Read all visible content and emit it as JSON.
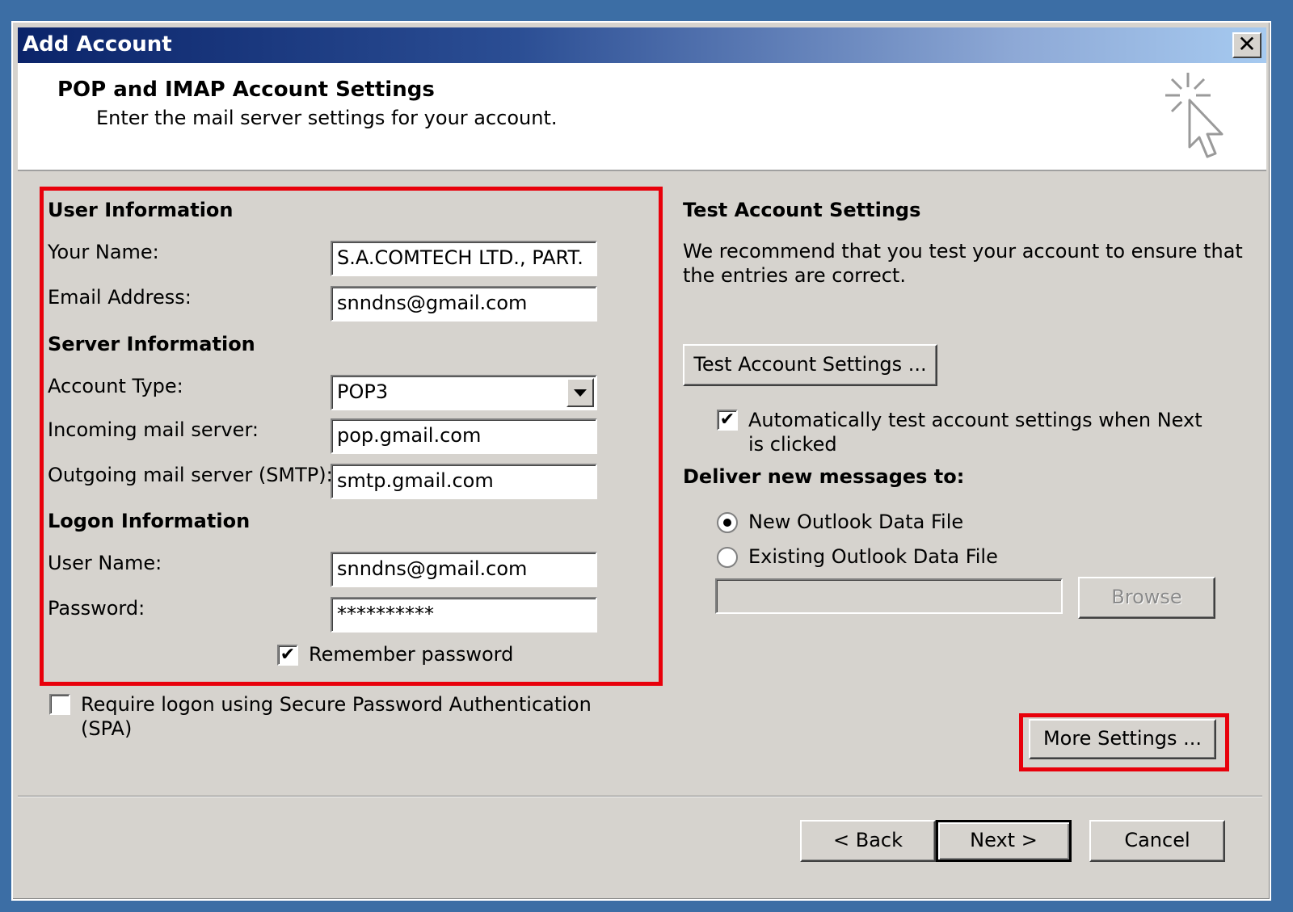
{
  "window": {
    "title": "Add Account",
    "close_label": "✕"
  },
  "header": {
    "title": "POP and IMAP Account Settings",
    "subtitle": "Enter the mail server settings for your account."
  },
  "user_info": {
    "heading": "User Information",
    "name_label": "Your Name:",
    "name_value": "S.A.COMTECH LTD., PART.",
    "email_label": "Email Address:",
    "email_value": "snndns@gmail.com"
  },
  "server_info": {
    "heading": "Server Information",
    "account_type_label": "Account Type:",
    "account_type_value": "POP3",
    "incoming_label": "Incoming mail server:",
    "incoming_value": "pop.gmail.com",
    "outgoing_label": "Outgoing mail server (SMTP):",
    "outgoing_value": "smtp.gmail.com"
  },
  "logon_info": {
    "heading": "Logon Information",
    "username_label": "User Name:",
    "username_value": "snndns@gmail.com",
    "password_label": "Password:",
    "password_value": "**********",
    "remember_label": "Remember password",
    "remember_checked": true
  },
  "spa": {
    "label_line1": "Require logon using Secure Password Authentication",
    "label_line2": "(SPA)",
    "checked": false
  },
  "test_settings": {
    "heading": "Test Account Settings",
    "description_line1": "We recommend that you test your account to ensure that",
    "description_line2": "the entries are correct.",
    "button_label": "Test Account Settings ...",
    "auto_test_line1": "Automatically test account settings when Next",
    "auto_test_line2": "is clicked",
    "auto_test_checked": true
  },
  "deliver": {
    "heading": "Deliver new messages to:",
    "option_new": "New Outlook Data File",
    "option_existing": "Existing Outlook Data File",
    "selected": "new",
    "browse_label": "Browse"
  },
  "more_settings_label": "More Settings ...",
  "footer": {
    "back_label": "< Back",
    "next_label": "Next >",
    "cancel_label": "Cancel"
  },
  "colors": {
    "highlight": "#e8000b",
    "dialog_bg": "#d6d3ce",
    "title_gradient_start": "#0b246a",
    "title_gradient_end": "#a6caf0",
    "desktop": "#3c6ea5"
  }
}
